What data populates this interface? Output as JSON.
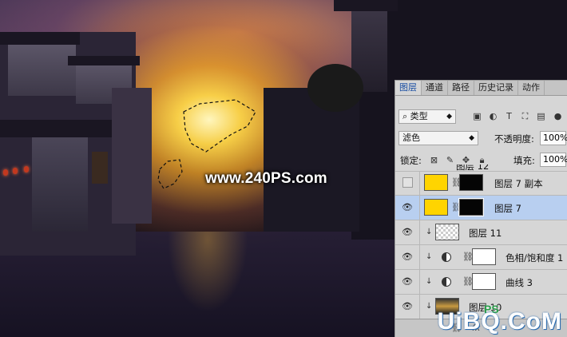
{
  "watermark": {
    "text": "www.240PS.com"
  },
  "logo": {
    "text": "UiBQ.CoM",
    "ps": "PS"
  },
  "panel": {
    "tabs": [
      {
        "label": "图层",
        "active": true
      },
      {
        "label": "通道"
      },
      {
        "label": "路径"
      },
      {
        "label": "历史记录"
      },
      {
        "label": "动作"
      }
    ],
    "filter": {
      "icon": "search-icon",
      "value": "类型"
    },
    "blend_mode": "滤色",
    "opacity_label": "不透明度:",
    "opacity_value": "100%",
    "lock_label": "锁定:",
    "fill_label": "填充:",
    "fill_value": "100%",
    "layers": [
      {
        "name": "图层 12",
        "visible": true,
        "thumb": "photo"
      },
      {
        "name": "图层 7 副本",
        "visible": false,
        "thumb": "yellow",
        "mask": "black"
      },
      {
        "name": "图层 7",
        "visible": true,
        "selected": true,
        "thumb": "yellow",
        "mask": "black"
      },
      {
        "name": "图层 11",
        "visible": true,
        "clipped": true,
        "thumb": "checker"
      },
      {
        "name": "色相/饱和度 1",
        "visible": true,
        "clipped": true,
        "adjustment": true,
        "mask": "white"
      },
      {
        "name": "曲线 3",
        "visible": true,
        "clipped": true,
        "adjustment": true,
        "mask": "white"
      },
      {
        "name": "图层 10",
        "visible": true,
        "clipped": true,
        "thumb": "photo"
      }
    ],
    "colors": {
      "selected_row": "#b8cff0",
      "accent_tab": "#1a4fa3",
      "swatch": "#ffd400"
    }
  }
}
